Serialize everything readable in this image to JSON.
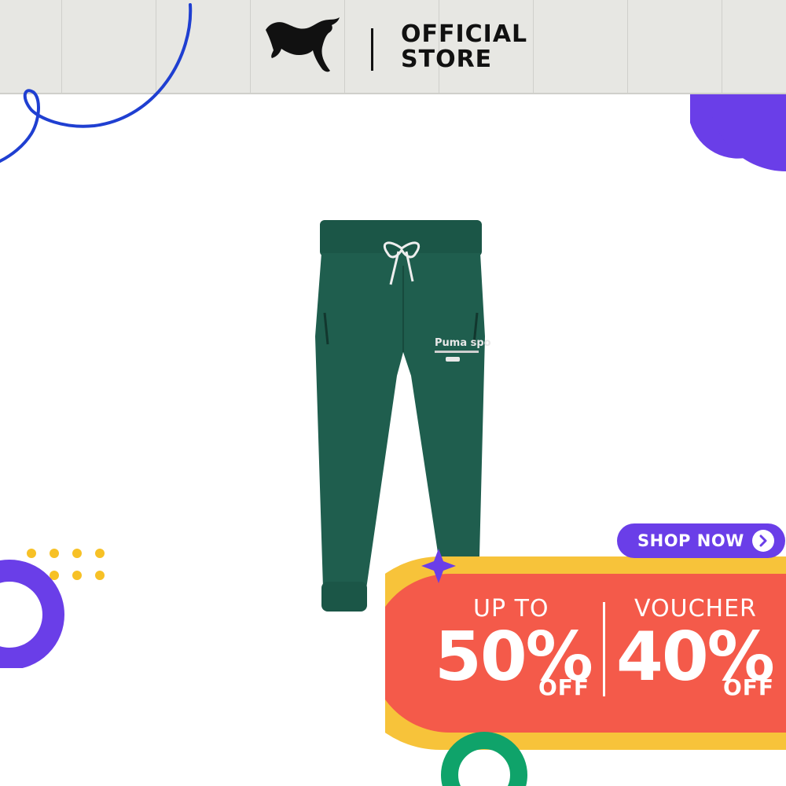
{
  "header": {
    "brand": "PUMA",
    "store_line1": "OFFICIAL",
    "store_line2": "STORE"
  },
  "product": {
    "print_line1": "Puma sports"
  },
  "promo": {
    "shop_now": "SHOP NOW",
    "left_label": "UP TO",
    "left_value": "50%",
    "left_off": "OFF",
    "right_label": "VOUCHER",
    "right_value": "40%",
    "right_off": "OFF"
  },
  "colors": {
    "header_bg": "#e7e7e3",
    "purple": "#6a3ee8",
    "promo_red": "#f45a4a",
    "promo_yellow": "#f7c33a",
    "product_green": "#1f5e4e",
    "accent_blue": "#1f3fd1",
    "dot_yellow": "#f7c126",
    "ring_green": "#0fa36a"
  },
  "icons": {
    "logo": "puma-cat-logo",
    "shop_now_arrow": "chevron-right-icon"
  }
}
